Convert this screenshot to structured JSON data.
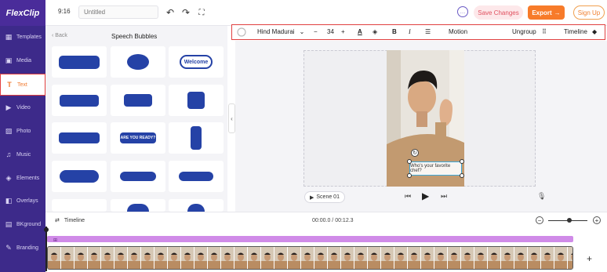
{
  "header": {
    "logo": "FlexClip",
    "aspect_ratio": "9:16",
    "title_placeholder": "Untitled",
    "save_label": "Save Changes",
    "export_label": "Export",
    "signup_label": "Sign Up"
  },
  "sidebar": {
    "items": [
      {
        "label": "Templates",
        "icon": "templates-icon"
      },
      {
        "label": "Media",
        "icon": "media-icon"
      },
      {
        "label": "Text",
        "icon": "text-icon",
        "active": true
      },
      {
        "label": "Video",
        "icon": "video-icon"
      },
      {
        "label": "Photo",
        "icon": "photo-icon"
      },
      {
        "label": "Music",
        "icon": "music-icon"
      },
      {
        "label": "Elements",
        "icon": "elements-icon"
      },
      {
        "label": "Overlays",
        "icon": "overlays-icon"
      },
      {
        "label": "BKground",
        "icon": "background-icon"
      },
      {
        "label": "Branding",
        "icon": "branding-icon"
      }
    ]
  },
  "panel": {
    "back_label": "Back",
    "title": "Speech Bubbles",
    "tiles": [
      {
        "text": ""
      },
      {
        "text": ""
      },
      {
        "text": "Welcome"
      },
      {
        "text": ""
      },
      {
        "text": ""
      },
      {
        "text": ""
      },
      {
        "text": ""
      },
      {
        "text": "ARE YOU READY?"
      },
      {
        "text": ""
      },
      {
        "text": ""
      },
      {
        "text": ""
      },
      {
        "text": ""
      },
      {
        "text": ""
      },
      {
        "text": ""
      },
      {
        "text": ""
      }
    ]
  },
  "toolbar": {
    "font_family": "Hind Madurai",
    "font_size": "34",
    "motion_label": "Motion",
    "ungroup_label": "Ungroup",
    "timeline_label": "Timeline"
  },
  "canvas": {
    "caption_text": "Who's your favorite chef?",
    "scene_label": "Scene 01"
  },
  "timeline": {
    "label": "Timeline",
    "time_display": "00:00.0 / 00:12.3"
  },
  "colors": {
    "brand_purple": "#3d2a8a",
    "accent_orange": "#f77b2a",
    "bubble_blue": "#2542a6",
    "text_track": "#d08be8"
  }
}
